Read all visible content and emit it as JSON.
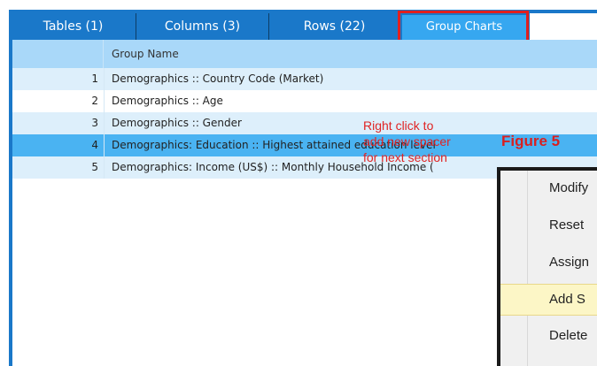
{
  "tabs": [
    {
      "label": "Tables (1)"
    },
    {
      "label": "Columns (3)"
    },
    {
      "label": "Rows (22)"
    },
    {
      "label": "Group Charts",
      "active": true
    }
  ],
  "grid": {
    "header": "Group Name",
    "rows": [
      {
        "num": "1",
        "name": "Demographics :: Country Code (Market)"
      },
      {
        "num": "2",
        "name": "Demographics :: Age"
      },
      {
        "num": "3",
        "name": "Demographics :: Gender"
      },
      {
        "num": "4",
        "name": "Demographics: Education :: Highest attained education level",
        "selected": true
      },
      {
        "num": "5",
        "name": "Demographics: Income (US$) :: Monthly Household Income ("
      }
    ]
  },
  "annotation": {
    "lines": [
      "Right click to",
      "add new spacer",
      "for next section"
    ],
    "figure_label": "Figure 5"
  },
  "context_menu": {
    "items": [
      {
        "label": "Modify"
      },
      {
        "label": "Reset"
      },
      {
        "label": "Assign"
      },
      {
        "label": "Add S",
        "highlighted": true
      },
      {
        "label": "Delete"
      }
    ]
  },
  "colors": {
    "app_blue": "#1a78c9",
    "active_tab": "#36a7f0",
    "header": "#a9d8f9",
    "selected_row": "#4ab3f2",
    "annotation_red": "#e02424"
  }
}
